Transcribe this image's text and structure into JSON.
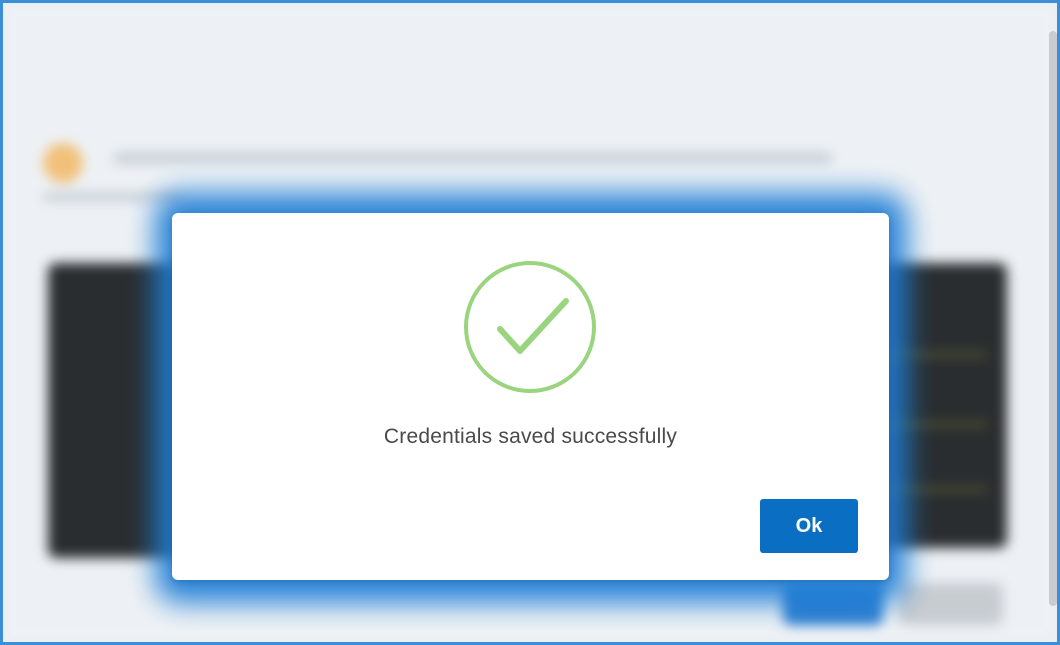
{
  "dialog": {
    "message": "Credentials saved successfully",
    "ok_label": "Ok",
    "icon": "checkmark-circle-icon"
  },
  "colors": {
    "accent": "#0a6fc2",
    "success": "#9ad47e",
    "glow": "#1f7ed6",
    "frame_border": "#3a8fd6"
  }
}
